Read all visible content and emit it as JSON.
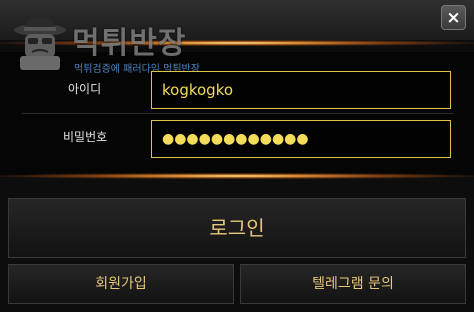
{
  "header": {
    "close_label": "×",
    "logo_text": "먹튀반장",
    "logo_subtitle": "먹튀검증에 패러다임 먹튀반장",
    "mascot_icon": "detective-mascot-icon"
  },
  "form": {
    "id_label": "아이디",
    "id_value": "kogkogko",
    "pw_label": "비밀번호",
    "pw_value": "●●●●●●●●●●●●"
  },
  "buttons": {
    "login": "로그인",
    "join": "회원가입",
    "telegram": "텔레그램 문의"
  },
  "colors": {
    "accent_gold": "#e0c34a",
    "button_text": "#e8c77a",
    "subtitle_blue": "#4a86c0"
  }
}
